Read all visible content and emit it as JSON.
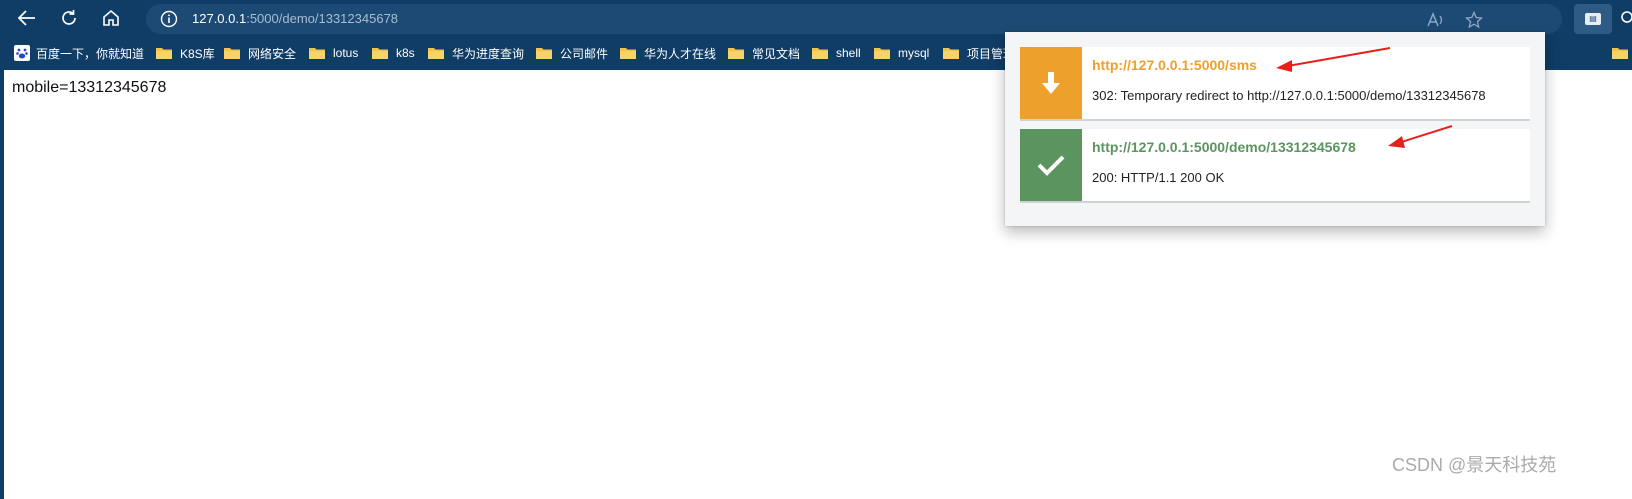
{
  "address_bar": {
    "host": "127.0.0.1",
    "rest": ":5000/demo/13312345678"
  },
  "bookmarks": [
    {
      "label": "百度一下，你就知道",
      "icon": "baidu-icon"
    },
    {
      "label": "K8S库",
      "icon": "folder-icon"
    },
    {
      "label": "网络安全",
      "icon": "folder-icon"
    },
    {
      "label": "lotus",
      "icon": "folder-icon"
    },
    {
      "label": "k8s",
      "icon": "folder-icon"
    },
    {
      "label": "华为进度查询",
      "icon": "folder-icon"
    },
    {
      "label": "公司邮件",
      "icon": "folder-icon"
    },
    {
      "label": "华为人才在线",
      "icon": "folder-icon"
    },
    {
      "label": "常见文档",
      "icon": "folder-icon"
    },
    {
      "label": "shell",
      "icon": "folder-icon"
    },
    {
      "label": "mysql",
      "icon": "folder-icon"
    },
    {
      "label": "项目管理",
      "icon": "folder-icon"
    }
  ],
  "page": {
    "body_text": "mobile=13312345678",
    "watermark": "CSDN @景天科技苑"
  },
  "redirect_popup": {
    "entries": [
      {
        "url": "http://127.0.0.1:5000/sms",
        "status": "302: Temporary redirect to http://127.0.0.1:5000/demo/13312345678",
        "color": "#eea02d",
        "icon": "down-arrow-icon"
      },
      {
        "url": "http://127.0.0.1:5000/demo/13312345678",
        "status": "200: HTTP/1.1 200 OK",
        "color": "#5c9460",
        "icon": "check-icon"
      }
    ]
  },
  "colors": {
    "chrome": "#0f3d66",
    "annotation_arrow": "#e8201c"
  }
}
